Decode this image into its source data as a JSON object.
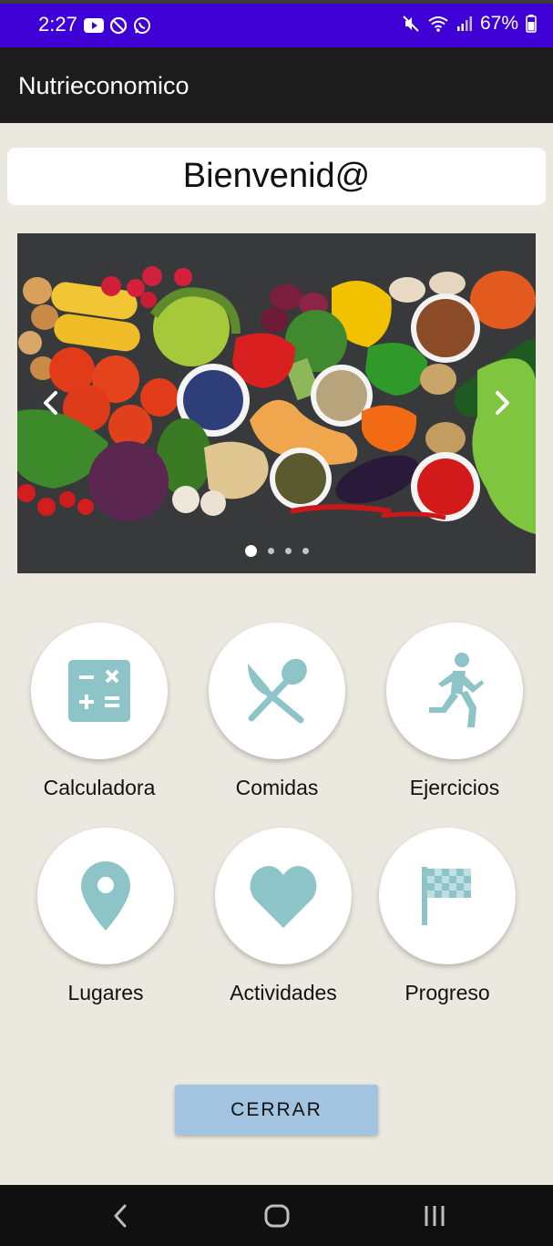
{
  "status_bar": {
    "time": "2:27",
    "battery": "67%",
    "color": "#3f00d6"
  },
  "app_bar": {
    "title": "Nutrieconomico"
  },
  "welcome_text": "Bienvenid@",
  "carousel": {
    "slide_count": 4,
    "active_index": 0,
    "prev_icon": "chevron-left-icon",
    "next_icon": "chevron-right-icon"
  },
  "menu": [
    {
      "label": "Calculadora",
      "icon": "calculator-icon"
    },
    {
      "label": "Comidas",
      "icon": "utensils-icon"
    },
    {
      "label": "Ejercicios",
      "icon": "running-person-icon"
    },
    {
      "label": "Lugares",
      "icon": "location-pin-icon"
    },
    {
      "label": "Actividades",
      "icon": "heart-icon"
    },
    {
      "label": "Progreso",
      "icon": "checkered-flag-icon"
    }
  ],
  "icon_color": "#8cc4c8",
  "close_button": {
    "label": "CERRAR",
    "color": "#a3c4e0"
  },
  "nav_bar": {
    "back_icon": "back-icon",
    "home_icon": "home-icon",
    "recents_icon": "recents-icon"
  }
}
